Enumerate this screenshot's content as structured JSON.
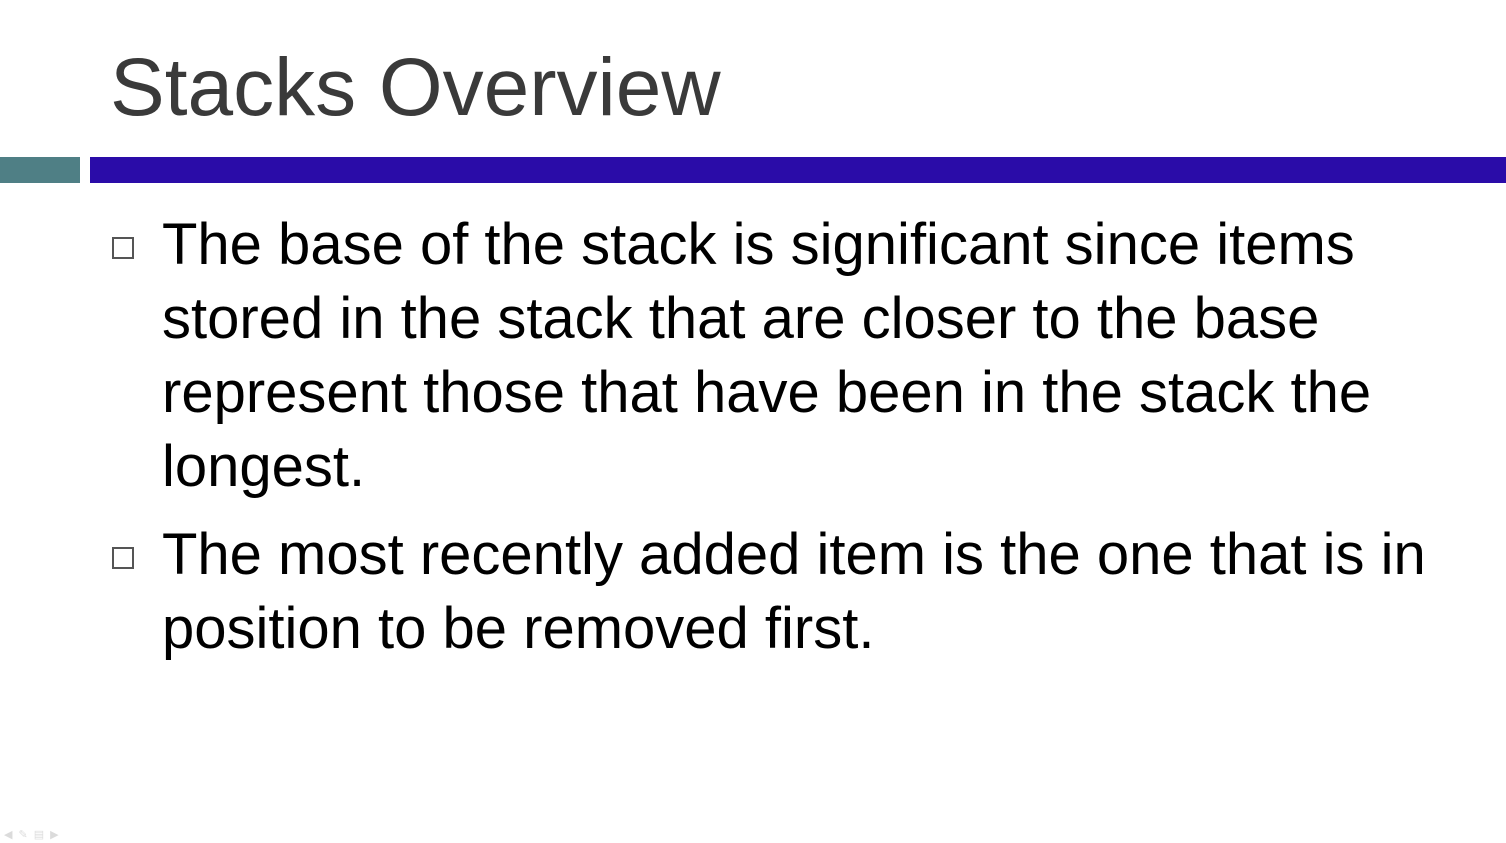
{
  "slide": {
    "title": "Stacks Overview",
    "bullets": [
      {
        "text": "The base of the stack is significant since items stored in the stack that are closer to the base represent those that have been in the stack the longest."
      },
      {
        "text": "The most recently added item is the one that is in position to be removed first."
      }
    ]
  },
  "colors": {
    "title_text": "#3a3a3a",
    "accent_bar": "#4f7f85",
    "main_bar": "#2a0ca8",
    "body_text": "#000000"
  },
  "icons": {
    "bullet": "hollow-square-icon",
    "nav_prev": "arrow-left-icon",
    "nav_edit": "pencil-icon",
    "nav_menu": "menu-icon",
    "nav_next": "arrow-right-icon"
  }
}
